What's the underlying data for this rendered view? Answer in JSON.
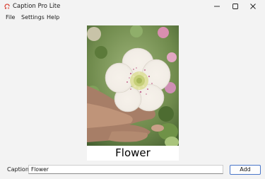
{
  "window": {
    "title": "Caption Pro Lite",
    "icon": "caption-app-icon",
    "controls": [
      "minimize-icon",
      "maximize-icon",
      "close-icon"
    ]
  },
  "menu": {
    "items": [
      {
        "label": "File"
      },
      {
        "label": "Settings"
      },
      {
        "label": "Help"
      }
    ]
  },
  "image": {
    "subject": "white hellebore flower held in a hand",
    "overlay_caption": "Flower"
  },
  "caption_form": {
    "label": "Caption",
    "value": "Flower",
    "add_label": "Add"
  },
  "colors": {
    "window_bg": "#f3f3f3",
    "accent_border": "#4a77c9",
    "icon_red": "#d9473a"
  }
}
